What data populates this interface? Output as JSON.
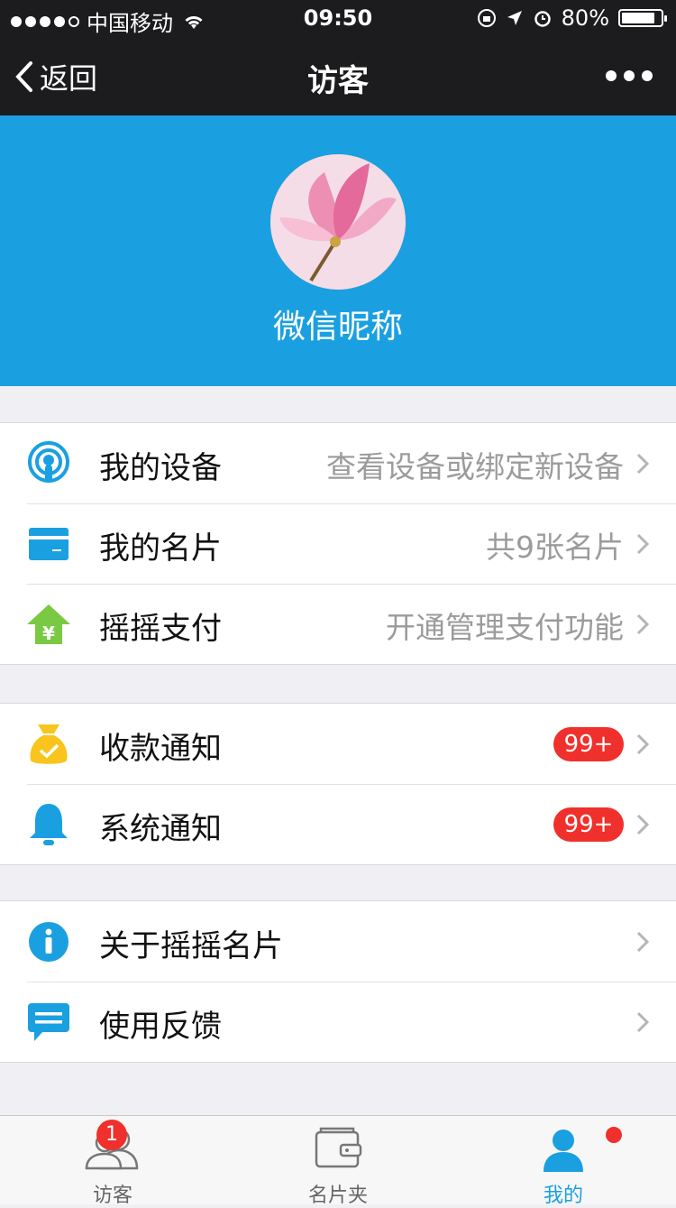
{
  "status": {
    "carrier": "中国移动",
    "time": "09:50",
    "battery": "80%"
  },
  "nav": {
    "back_label": "返回",
    "title": "访客"
  },
  "profile": {
    "nickname": "微信昵称"
  },
  "groups": [
    {
      "items": [
        {
          "label": "我的设备",
          "value": "查看设备或绑定新设备",
          "icon": "device-icon"
        },
        {
          "label": "我的名片",
          "value": "共9张名片",
          "icon": "card-icon"
        },
        {
          "label": "摇摇支付",
          "value": "开通管理支付功能",
          "icon": "payment-icon"
        }
      ]
    },
    {
      "items": [
        {
          "label": "收款通知",
          "badge": "99+",
          "icon": "money-bag-icon"
        },
        {
          "label": "系统通知",
          "badge": "99+",
          "icon": "bell-icon"
        }
      ]
    },
    {
      "items": [
        {
          "label": "关于摇摇名片",
          "icon": "info-icon"
        },
        {
          "label": "使用反馈",
          "icon": "feedback-icon"
        }
      ]
    }
  ],
  "tabs": [
    {
      "label": "访客",
      "badge": "1",
      "icon": "visitors-icon"
    },
    {
      "label": "名片夹",
      "icon": "cardholder-icon"
    },
    {
      "label": "我的",
      "icon": "me-icon",
      "active": true
    }
  ],
  "colors": {
    "header_bg": "#1aa0e0",
    "badge_red": "#f0302c",
    "icon_blue": "#1aa0e0",
    "icon_green": "#7ac943",
    "icon_yellow": "#f9c51c"
  }
}
